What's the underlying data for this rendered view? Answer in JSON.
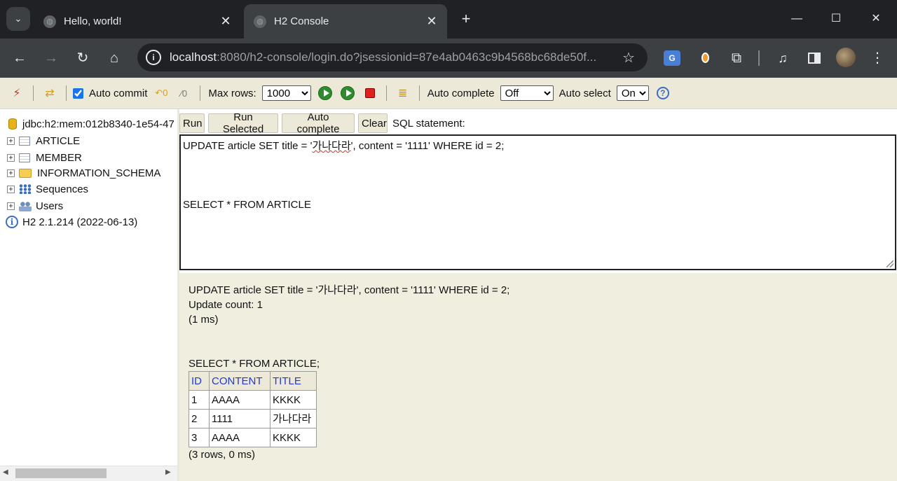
{
  "browser": {
    "tabs": [
      {
        "title": "Hello, world!",
        "active": false
      },
      {
        "title": "H2 Console",
        "active": true
      }
    ],
    "url_host": "localhost",
    "url_rest": ":8080/h2-console/login.do?jsessionid=87e4ab0463c9b4568bc68de50f...",
    "extensions": [
      "translate-icon",
      "dropper-icon",
      "puzzle-icon",
      "media-icon",
      "side-panel-icon",
      "avatar",
      "menu-icon"
    ]
  },
  "toolbar": {
    "auto_commit_label": "Auto commit",
    "auto_commit_checked": true,
    "max_rows_label": "Max rows:",
    "max_rows_value": "1000",
    "auto_complete_label": "Auto complete",
    "auto_complete_value": "Off",
    "auto_select_label": "Auto select",
    "auto_select_value": "On"
  },
  "tree": {
    "connection": "jdbc:h2:mem:012b8340-1e54-47",
    "items": [
      {
        "label": "ARTICLE",
        "icon": "table-icon"
      },
      {
        "label": "MEMBER",
        "icon": "table-icon"
      },
      {
        "label": "INFORMATION_SCHEMA",
        "icon": "folder-icon"
      },
      {
        "label": "Sequences",
        "icon": "sequences-icon"
      },
      {
        "label": "Users",
        "icon": "users-icon"
      }
    ],
    "version": "H2 2.1.214 (2022-06-13)"
  },
  "query": {
    "run": "Run",
    "run_selected": "Run Selected",
    "auto_complete": "Auto complete",
    "clear": "Clear",
    "sql_label": "SQL statement:",
    "sql_line1_pre": "UPDATE article SET title = '",
    "sql_line1_korean": "가나다라",
    "sql_line1_post": "', content = '1111' WHERE id = 2;",
    "sql_line2": "SELECT * FROM ARTICLE"
  },
  "result": {
    "update_stmt": "UPDATE article SET title = '가나다라', content = '1111' WHERE id = 2;",
    "update_count": "Update count: 1",
    "update_time": "(1 ms)",
    "select_stmt": "SELECT * FROM ARTICLE;",
    "columns": [
      "ID",
      "CONTENT",
      "TITLE"
    ],
    "rows": [
      [
        "1",
        "AAAA",
        "KKKK"
      ],
      [
        "2",
        "1111",
        "가나다라"
      ],
      [
        "3",
        "AAAA",
        "KKKK"
      ]
    ],
    "summary": "(3 rows, 0 ms)"
  }
}
